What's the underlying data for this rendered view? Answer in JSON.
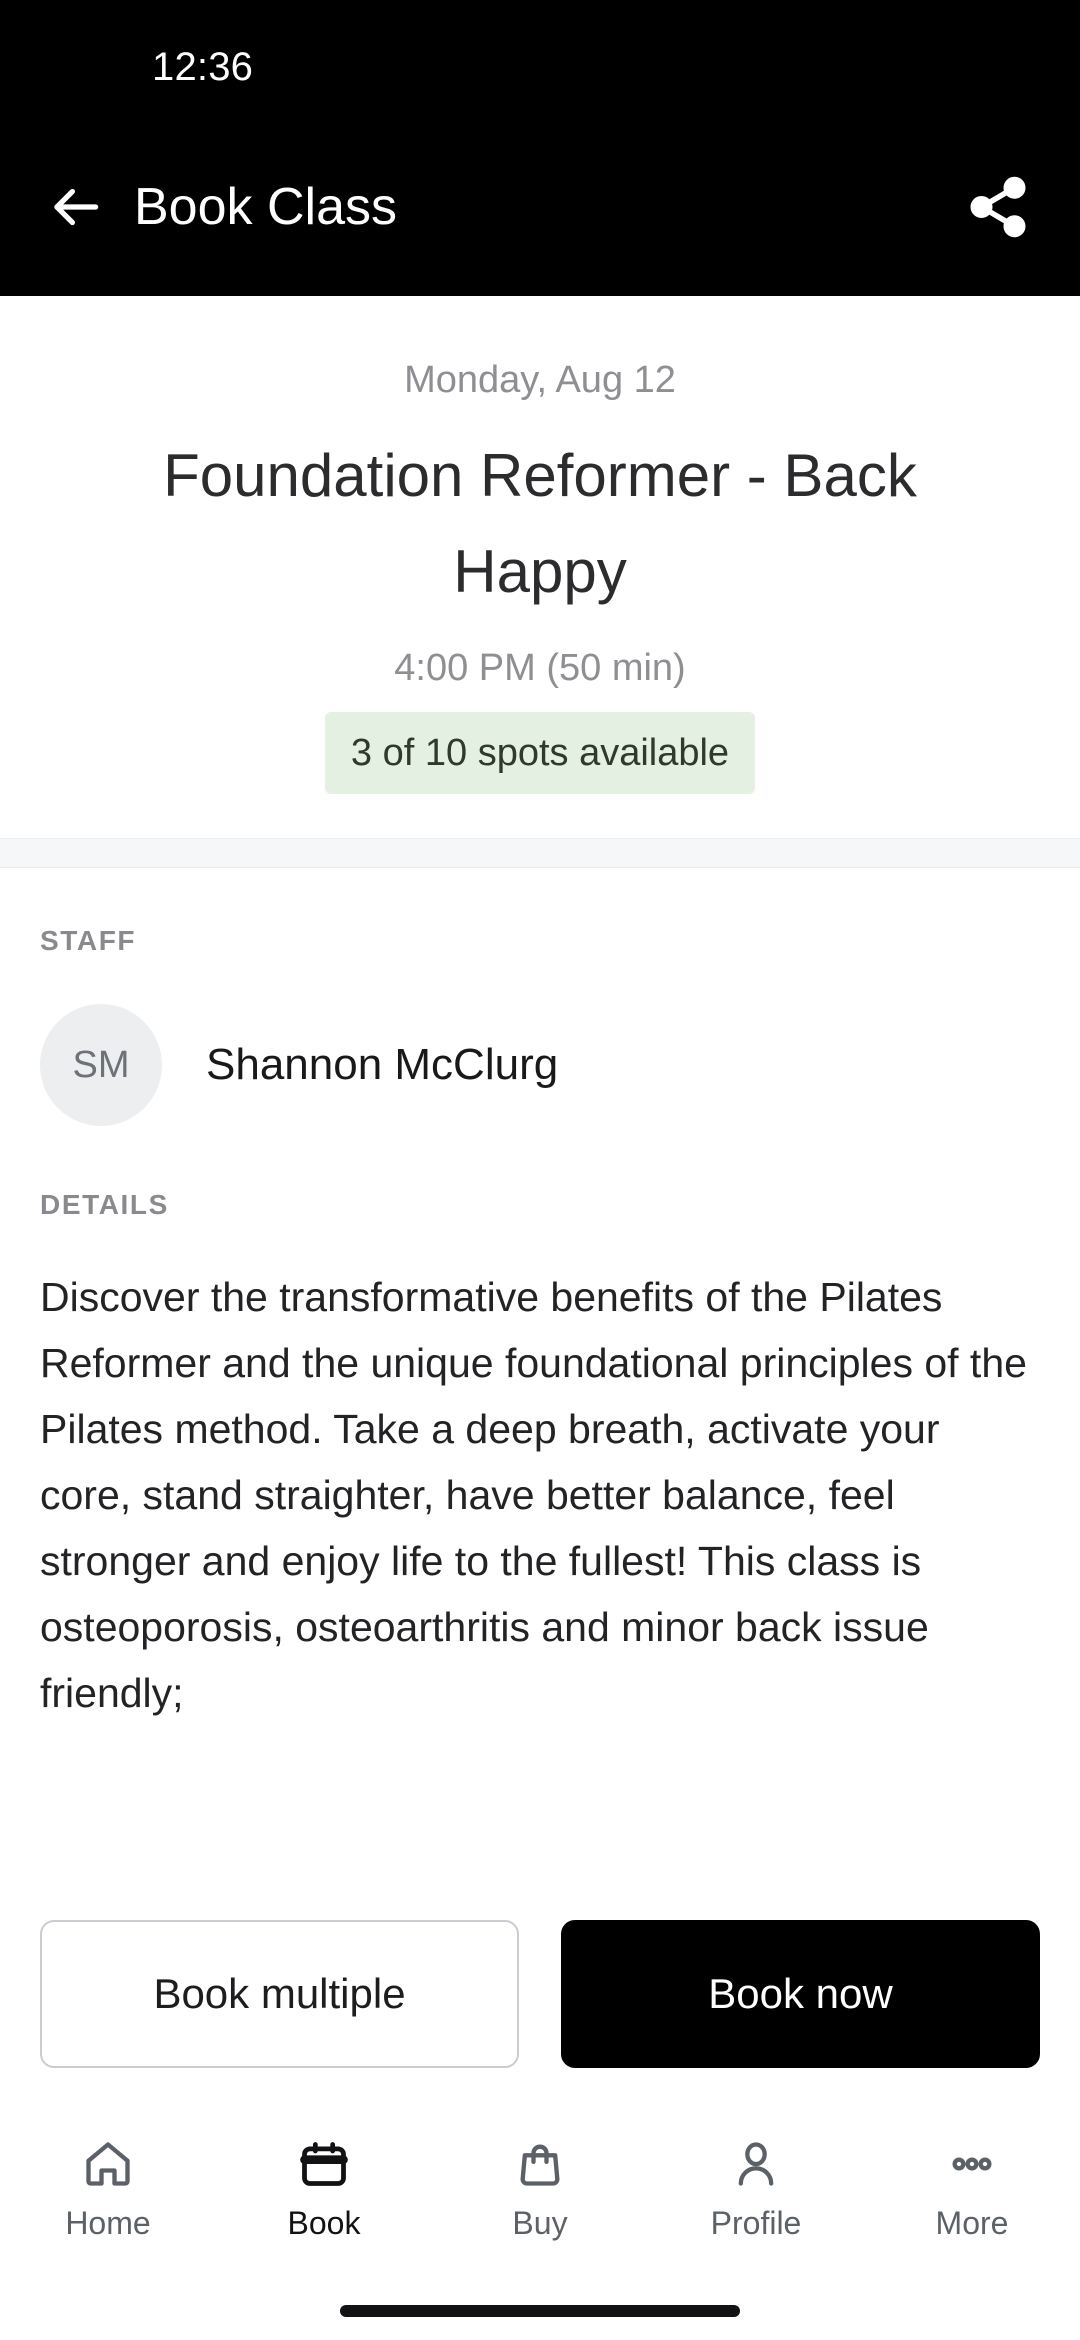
{
  "status_bar": {
    "time": "12:36"
  },
  "app_bar": {
    "title": "Book Class",
    "back_icon": "arrow-left-icon",
    "share_icon": "share-icon"
  },
  "class_header": {
    "date": "Monday, Aug 12",
    "title": "Foundation Reformer - Back Happy",
    "time": "4:00 PM (50 min)",
    "availability": "3 of 10 spots available",
    "availability_bg_color": "#e4f0e1",
    "availability_text_color": "#2f3a2b"
  },
  "staff": {
    "section_label": "STAFF",
    "avatar_initials": "SM",
    "name": "Shannon McClurg"
  },
  "details": {
    "section_label": "DETAILS",
    "text": "Discover the transformative benefits of the Pilates Reformer and the unique foundational principles of the Pilates method. Take a deep breath, activate your core, stand straighter, have better balance, feel stronger and enjoy life to the fullest! This class is osteoporosis, osteoarthritis and minor back issue friendly;"
  },
  "actions": {
    "secondary_label": "Book multiple",
    "primary_label": "Book now",
    "primary_bg_color": "#000000",
    "primary_text_color": "#ffffff"
  },
  "bottom_nav": {
    "items": [
      {
        "label": "Home",
        "icon": "home-icon",
        "active": false
      },
      {
        "label": "Book",
        "icon": "calendar-icon",
        "active": true
      },
      {
        "label": "Buy",
        "icon": "bag-icon",
        "active": false
      },
      {
        "label": "Profile",
        "icon": "person-icon",
        "active": false
      },
      {
        "label": "More",
        "icon": "dots-icon",
        "active": false
      }
    ]
  }
}
